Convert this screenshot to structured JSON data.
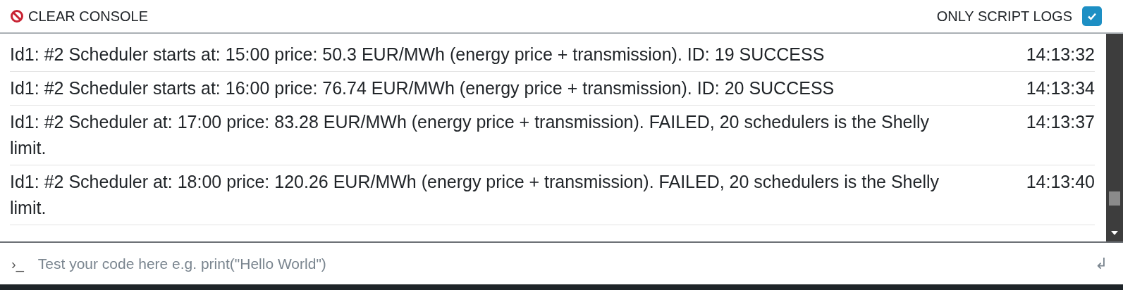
{
  "toolbar": {
    "clear_button": "CLEAR CONSOLE",
    "only_script_logs": {
      "label": "ONLY SCRIPT LOGS",
      "checked": true
    }
  },
  "log": [
    {
      "message": "Id1: #2 Scheduler starts at: 15:00 price: 50.3 EUR/MWh (energy price + transmission). ID: 19 SUCCESS",
      "time": "14:13:32"
    },
    {
      "message": "Id1: #2 Scheduler starts at: 16:00 price: 76.74 EUR/MWh (energy price + transmission). ID: 20 SUCCESS",
      "time": "14:13:34"
    },
    {
      "message": "Id1: #2 Scheduler at: 17:00 price: 83.28 EUR/MWh (energy price + transmission). FAILED, 20 schedulers is the Shelly limit.",
      "time": "14:13:37"
    },
    {
      "message": "Id1: #2 Scheduler at: 18:00 price: 120.26 EUR/MWh (energy price + transmission). FAILED, 20 schedulers is the Shelly limit.",
      "time": "14:13:40"
    }
  ],
  "console_input": {
    "prompt": "›_",
    "placeholder": "Test your code here e.g. print(\"Hello World\")",
    "submit": "↲"
  }
}
